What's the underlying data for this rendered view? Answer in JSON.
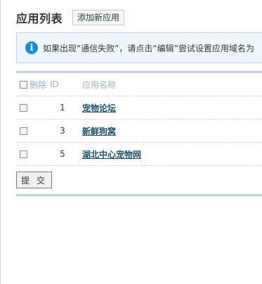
{
  "header": {
    "title": "应用列表",
    "add_button": "添加新应用"
  },
  "notice": {
    "icon": "info-icon",
    "icon_glyph": "i",
    "text": "如果出现“通信失败”，请点击“编辑”尝试设置应用域名为"
  },
  "table": {
    "headers": {
      "delete": "删除",
      "id": "ID",
      "name": "应用名称"
    },
    "rows": [
      {
        "id": "1",
        "name": "宠物论坛",
        "checked": false
      },
      {
        "id": "3",
        "name": "新鲜狗窝",
        "checked": false
      },
      {
        "id": "5",
        "name": "湖北中心宠物网",
        "checked": false
      }
    ]
  },
  "submit_label": "提 交",
  "colors": {
    "link": "#1d4f6b",
    "info_icon": "#1e8ad6",
    "rule": "#bcd2dd",
    "notice_bg": "#f0f7fb"
  }
}
